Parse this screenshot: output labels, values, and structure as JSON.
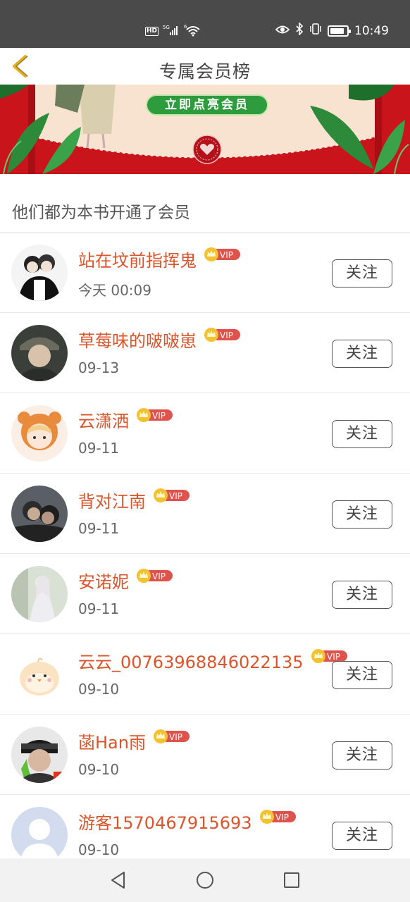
{
  "status_bar": {
    "hd": "HD",
    "network": "5G",
    "wifi_tag": "6",
    "time": "10:49",
    "battery_level": 0.85
  },
  "header": {
    "title": "专属会员榜"
  },
  "banner": {
    "cta_label": "立即点亮会员"
  },
  "section": {
    "title": "他们都为本书开通了会员"
  },
  "vip_label": "VIP",
  "follow_label": "关注",
  "members": [
    {
      "name": "站在坟前指挥鬼",
      "date": "今天 00:09"
    },
    {
      "name": "草莓味的啵啵崽",
      "date": "09-13"
    },
    {
      "name": "云潇洒",
      "date": "09-11"
    },
    {
      "name": "背对江南",
      "date": "09-11"
    },
    {
      "name": "安诺妮",
      "date": "09-11"
    },
    {
      "name": "云云_00763968846022135",
      "date": "09-10"
    },
    {
      "name": "菡Han雨",
      "date": "09-10"
    },
    {
      "name": "游客1570467915693",
      "date": "09-10"
    }
  ],
  "colors": {
    "accent_name": "#d9562c",
    "vip_badge": "#e0534d",
    "crown": "#f2c230",
    "banner_red": "#c8141a",
    "cta_green": "#2e9b3c",
    "back_arrow": "#e0b020"
  }
}
